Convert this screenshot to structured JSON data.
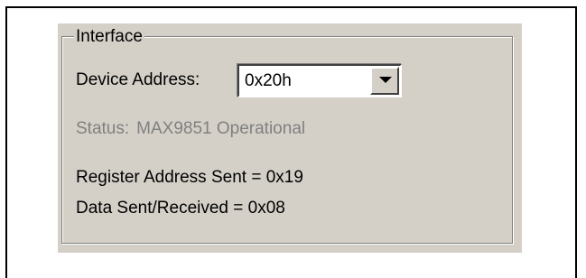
{
  "interface": {
    "group_title": "Interface",
    "device_address_label": "Device Address:",
    "device_address_value": "0x20h",
    "status_label": "Status:",
    "status_value": "MAX9851 Operational",
    "register_address_text": "Register Address Sent = 0x19",
    "data_text": "Data Sent/Received = 0x08"
  },
  "icons": {
    "dropdown": "chevron-down-icon"
  }
}
